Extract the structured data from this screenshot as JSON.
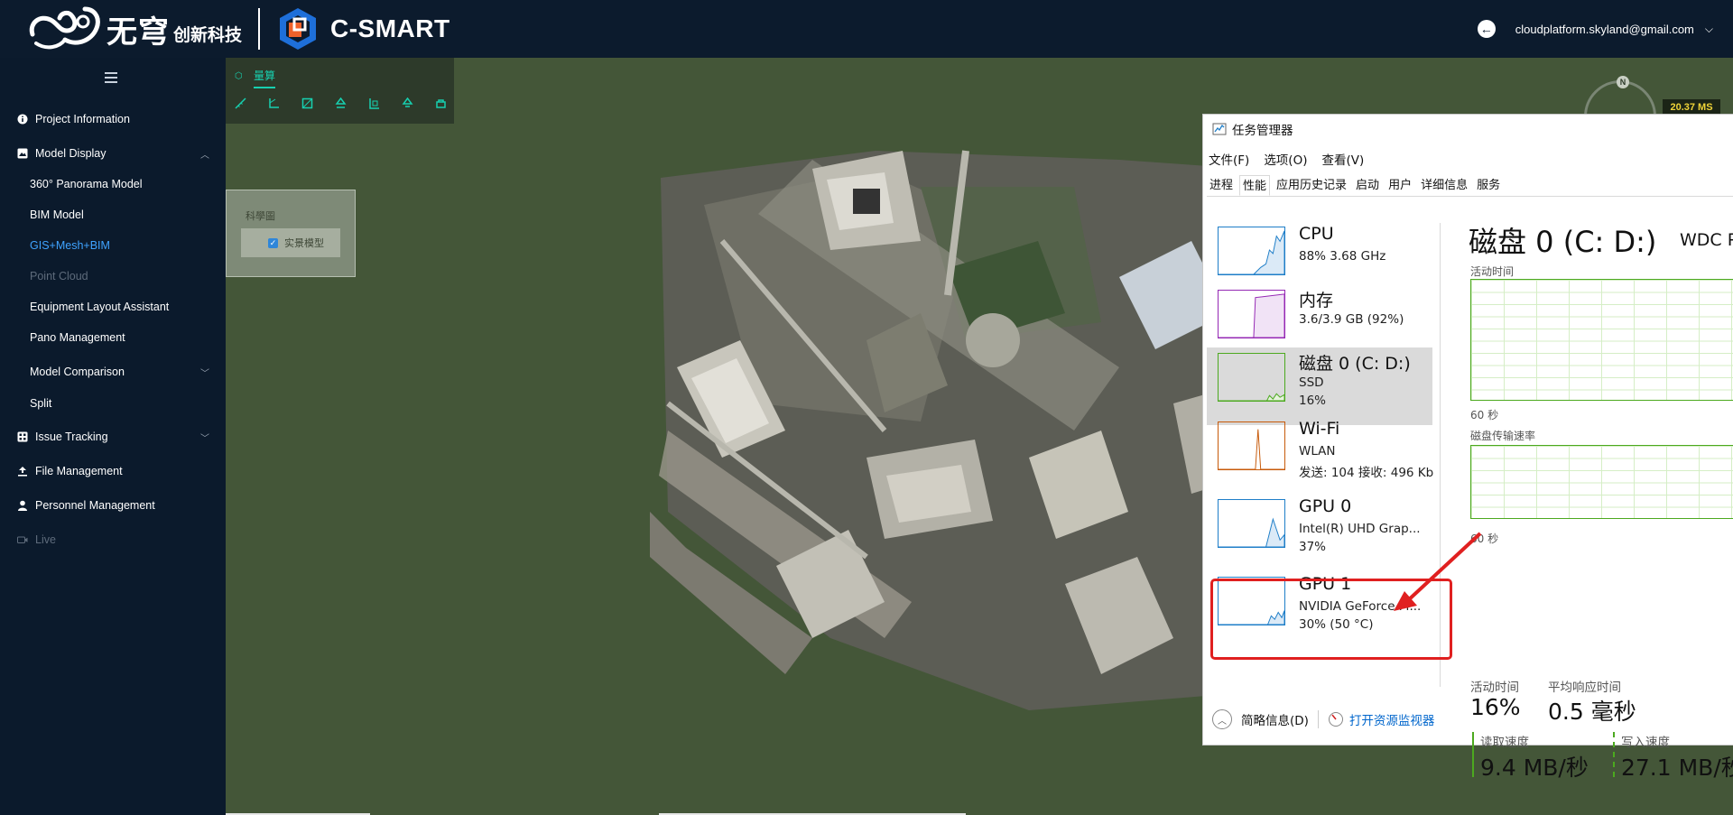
{
  "brand": {
    "company_name": "无穹",
    "company_tagline": "创新科技",
    "product_name": "C-SMART"
  },
  "header": {
    "user_email": "cloudplatform.skyland@gmail.com"
  },
  "sidebar": {
    "items": [
      {
        "label": "Project Information",
        "icon": "info-icon",
        "level": 1
      },
      {
        "label": "Model Display",
        "icon": "image-icon",
        "level": 1,
        "expanded": true
      },
      {
        "label": "360° Panorama Model",
        "level": 2
      },
      {
        "label": "BIM Model",
        "level": 2
      },
      {
        "label": "GIS+Mesh+BIM",
        "level": 2,
        "active": true
      },
      {
        "label": "Point Cloud",
        "level": 2,
        "disabled": true
      },
      {
        "label": "Equipment Layout Assistant",
        "level": 2
      },
      {
        "label": "Pano Management",
        "level": 2
      },
      {
        "label": "Model Comparison",
        "level": 2,
        "expandable": true
      },
      {
        "label": "Split",
        "level": 2
      },
      {
        "label": "Issue Tracking",
        "icon": "grid-icon",
        "level": 1,
        "expandable": true
      },
      {
        "label": "File Management",
        "icon": "upload-icon",
        "level": 1
      },
      {
        "label": "Personnel Management",
        "icon": "user-icon",
        "level": 1
      },
      {
        "label": "Live",
        "icon": "video-icon",
        "level": 1,
        "disabled": true
      }
    ],
    "active_color": "#3fa3ff"
  },
  "viewer": {
    "tab_label": "量算",
    "tools": [
      "ruler-icon",
      "angle-icon",
      "area-icon",
      "height-icon",
      "section-icon",
      "volume-icon",
      "clear-icon"
    ],
    "layer_panel_title": "科學圖",
    "layer_item_label": "实景模型",
    "fps_label": "20.37 MS",
    "compass_label": "N",
    "accent_color": "#17d0b0"
  },
  "taskmgr": {
    "title": "任务管理器",
    "menu": [
      "文件(F)",
      "选项(O)",
      "查看(V)"
    ],
    "tabs": [
      "进程",
      "性能",
      "应用历史记录",
      "启动",
      "用户",
      "详细信息",
      "服务"
    ],
    "active_tab": "性能",
    "resources": [
      {
        "name": "CPU",
        "line1": "88%  3.68 GHz",
        "line2": "",
        "color": "#1e7ec8"
      },
      {
        "name": "内存",
        "line1": "3.6/3.9 GB (92%)",
        "line2": "",
        "color": "#9528b4"
      },
      {
        "name": "磁盘 0 (C: D:)",
        "line1": "SSD",
        "line2": "16%",
        "color": "#4ca91f",
        "selected": true
      },
      {
        "name": "Wi-Fi",
        "line1": "WLAN",
        "line2": "发送: 104  接收: 496 Kb",
        "color": "#c75a0a"
      },
      {
        "name": "GPU 0",
        "line1": "Intel(R) UHD Grap...",
        "line2": "37%",
        "color": "#1e7ec8"
      },
      {
        "name": "GPU 1",
        "line1": "NVIDIA GeForce M...",
        "line2": "30% (50 °C)",
        "color": "#1e7ec8"
      }
    ],
    "detail": {
      "title": "磁盘 0 (C: D:)",
      "model": "WDC P",
      "active_time_label": "活动时间",
      "transfer_rate_label": "磁盘传输速率",
      "axis_label_1": "60 秒",
      "axis_label_2": "60 秒",
      "stat_active_label": "活动时间",
      "stat_active_value": "16%",
      "stat_response_label": "平均响应时间",
      "stat_response_value": "0.5 毫秒",
      "stat_read_label": "读取速度",
      "stat_read_value": "9.4 MB/秒",
      "stat_write_label": "写入速度",
      "stat_write_value": "27.1 MB/秒"
    },
    "footer": {
      "summary_label": "简略信息(D)",
      "monitor_label": "打开资源监视器"
    }
  }
}
